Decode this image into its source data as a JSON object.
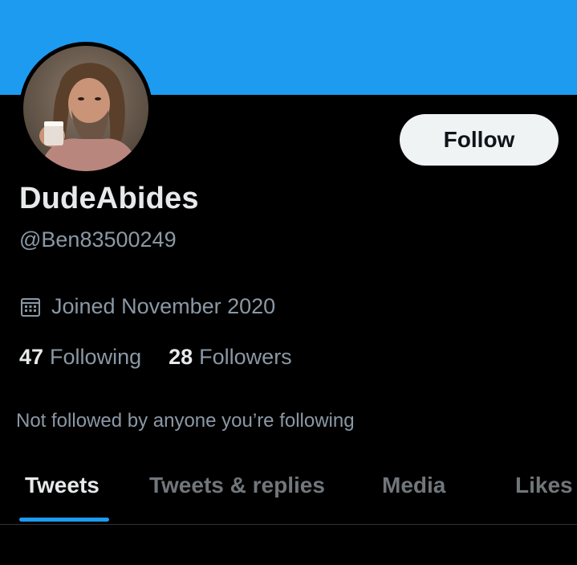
{
  "colors": {
    "banner": "#1d9bf0",
    "accent": "#1d9bf0",
    "background": "#000000",
    "primary_text": "#e7e9ea",
    "secondary_text": "#8b98a5"
  },
  "profile": {
    "follow_label": "Follow",
    "display_name": "DudeAbides",
    "handle": "@Ben83500249",
    "joined_icon": "calendar-icon",
    "joined": "Joined November 2020",
    "following_count": "47",
    "following_label": "Following",
    "followers_count": "28",
    "followers_label": "Followers",
    "not_followed": "Not followed by anyone you’re following"
  },
  "tabs": [
    {
      "label": "Tweets",
      "active": true
    },
    {
      "label": "Tweets & replies",
      "active": false
    },
    {
      "label": "Media",
      "active": false
    },
    {
      "label": "Likes",
      "active": false
    }
  ]
}
